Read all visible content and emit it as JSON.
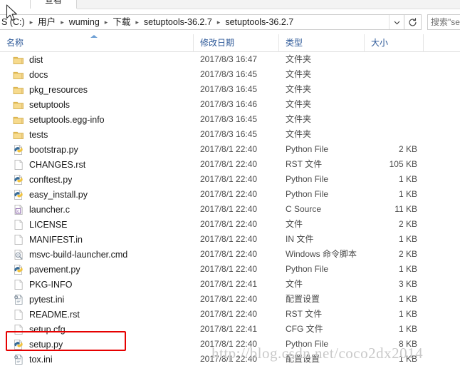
{
  "window": {
    "ribbon_tab_label": "查看"
  },
  "address_bar": {
    "crumbs": [
      "S (C:)",
      "用户",
      "wuming",
      "下载",
      "setuptools-36.2.7",
      "setuptools-36.2.7"
    ],
    "separator": "▸",
    "dropdown_icon": "chevron-down-icon",
    "refresh_icon": "refresh-icon"
  },
  "search": {
    "placeholder": "搜索\"setu...",
    "value": ""
  },
  "columns": {
    "name": "名称",
    "date_modified": "修改日期",
    "type": "类型",
    "size": "大小"
  },
  "files": [
    {
      "name": "dist",
      "date": "2017/8/3 16:47",
      "type": "文件夹",
      "size": "",
      "icon": "folder-icon"
    },
    {
      "name": "docs",
      "date": "2017/8/3 16:45",
      "type": "文件夹",
      "size": "",
      "icon": "folder-icon"
    },
    {
      "name": "pkg_resources",
      "date": "2017/8/3 16:45",
      "type": "文件夹",
      "size": "",
      "icon": "folder-icon"
    },
    {
      "name": "setuptools",
      "date": "2017/8/3 16:46",
      "type": "文件夹",
      "size": "",
      "icon": "folder-icon"
    },
    {
      "name": "setuptools.egg-info",
      "date": "2017/8/3 16:45",
      "type": "文件夹",
      "size": "",
      "icon": "folder-icon"
    },
    {
      "name": "tests",
      "date": "2017/8/3 16:45",
      "type": "文件夹",
      "size": "",
      "icon": "folder-icon"
    },
    {
      "name": "bootstrap.py",
      "date": "2017/8/1 22:40",
      "type": "Python File",
      "size": "2 KB",
      "icon": "python-file-icon"
    },
    {
      "name": "CHANGES.rst",
      "date": "2017/8/1 22:40",
      "type": "RST 文件",
      "size": "105 KB",
      "icon": "blank-file-icon"
    },
    {
      "name": "conftest.py",
      "date": "2017/8/1 22:40",
      "type": "Python File",
      "size": "1 KB",
      "icon": "python-file-icon"
    },
    {
      "name": "easy_install.py",
      "date": "2017/8/1 22:40",
      "type": "Python File",
      "size": "1 KB",
      "icon": "python-file-icon"
    },
    {
      "name": "launcher.c",
      "date": "2017/8/1 22:40",
      "type": "C Source",
      "size": "11 KB",
      "icon": "c-source-icon"
    },
    {
      "name": "LICENSE",
      "date": "2017/8/1 22:40",
      "type": "文件",
      "size": "2 KB",
      "icon": "blank-file-icon"
    },
    {
      "name": "MANIFEST.in",
      "date": "2017/8/1 22:40",
      "type": "IN 文件",
      "size": "1 KB",
      "icon": "blank-file-icon"
    },
    {
      "name": "msvc-build-launcher.cmd",
      "date": "2017/8/1 22:40",
      "type": "Windows 命令脚本",
      "size": "2 KB",
      "icon": "cmd-script-icon"
    },
    {
      "name": "pavement.py",
      "date": "2017/8/1 22:40",
      "type": "Python File",
      "size": "1 KB",
      "icon": "python-file-icon"
    },
    {
      "name": "PKG-INFO",
      "date": "2017/8/1 22:41",
      "type": "文件",
      "size": "3 KB",
      "icon": "blank-file-icon"
    },
    {
      "name": "pytest.ini",
      "date": "2017/8/1 22:40",
      "type": "配置设置",
      "size": "1 KB",
      "icon": "config-settings-icon"
    },
    {
      "name": "README.rst",
      "date": "2017/8/1 22:40",
      "type": "RST 文件",
      "size": "1 KB",
      "icon": "blank-file-icon"
    },
    {
      "name": "setup.cfg",
      "date": "2017/8/1 22:41",
      "type": "CFG 文件",
      "size": "1 KB",
      "icon": "blank-file-icon"
    },
    {
      "name": "setup.py",
      "date": "2017/8/1 22:40",
      "type": "Python File",
      "size": "8 KB",
      "icon": "python-file-icon"
    },
    {
      "name": "tox.ini",
      "date": "2017/8/1 22:40",
      "type": "配置设置",
      "size": "1 KB",
      "icon": "config-settings-icon"
    }
  ],
  "annotation": {
    "highlight_target": "setup.py",
    "color": "#e60000"
  },
  "watermark": {
    "text": "http://blog.csdn.net/coco2dx2014",
    "color": "#c9c9c9"
  }
}
